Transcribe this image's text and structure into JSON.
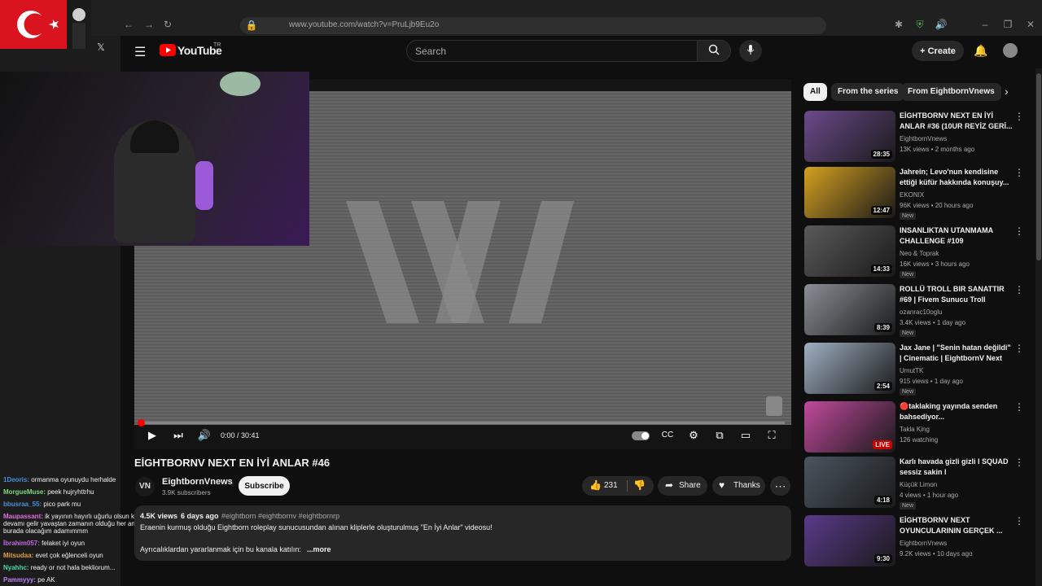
{
  "browser": {
    "url": "www.youtube.com/watch?v=PruLjb9Eu2o"
  },
  "header": {
    "logo_text": "YouTube",
    "logo_region": "TR",
    "search_placeholder": "Search",
    "create_label": "Create"
  },
  "video": {
    "title": "EİGHTBORNV NEXT EN İYİ ANLAR #46",
    "time": "0:00 / 30:41",
    "progress_fraction": 0.0,
    "channel_initials": "VN",
    "channel": "EightbornVnews",
    "subscribers": "3.9K subscribers",
    "subscribe_label": "Subscribe",
    "likes": "231",
    "share_label": "Share",
    "thanks_label": "Thanks",
    "desc_views": "4.5K views",
    "desc_date": "6 days ago",
    "desc_tags": "#eightborn #eightbornv #eightbornrp",
    "desc_line1": "Eraenin kurmuş olduğu Eightborn roleplay sunucusundan alınan kliplerle oluşturulmuş \"En İyi Anlar\" videosu!",
    "desc_line2": "Ayrıcalıklardan yararlanmak için bu kanala katılın:",
    "more_label": "...more"
  },
  "chips": [
    "All",
    "From the series",
    "From EightbornVnews"
  ],
  "recommendations": [
    {
      "title": "EİGHTBORNV NEXT EN İYİ ANLAR #36 (10UR REYİZ GERİ...",
      "channel": "EightbornVnews",
      "meta": "13K views • 2 months ago",
      "duration": "28:35",
      "new": "",
      "thumb_color": "#6b4a8a"
    },
    {
      "title": "Jahrein; Levo'nun kendisine ettiği küfür hakkında konuşuy...",
      "channel": "EKONIX",
      "meta": "96K views • 20 hours ago",
      "duration": "12:47",
      "new": "New",
      "thumb_color": "#d4a020"
    },
    {
      "title": "INSANLIKTAN UTANMAMA CHALLENGE #109",
      "channel": "Neo & Toprak",
      "meta": "16K views • 3 hours ago",
      "duration": "14:33",
      "new": "New",
      "thumb_color": "#5a5a5a"
    },
    {
      "title": "ROLLÜ TROLL BIR SANATTIR #69 | Fivem Sunucu Troll",
      "channel": "ozanrac10oglu",
      "meta": "3.4K views • 1 day ago",
      "duration": "8:39",
      "new": "New",
      "thumb_color": "#8a8f96"
    },
    {
      "title": "Jax Jane | \"Senin hatan değildi\" | Cinematic | EightbornV Next",
      "channel": "UmutTK",
      "meta": "915 views • 1 day ago",
      "duration": "2:54",
      "new": "New",
      "thumb_color": "#9fb0c2"
    },
    {
      "title": "🔴taklaking yayında senden bahsediyor...",
      "channel": "Takla King",
      "meta": "126 watching",
      "duration": "LIVE",
      "new": "",
      "thumb_color": "#c04a9c"
    },
    {
      "title": "Karlı havada gizli gizli l SQUAD sessiz sakin l",
      "channel": "Küçük Limon",
      "meta": "4 views • 1 hour ago",
      "duration": "4:18",
      "new": "New",
      "thumb_color": "#4a5560"
    },
    {
      "title": "EİGHTBORNV NEXT OYUNCULARININ GERÇEK ...",
      "channel": "EightbornVnews",
      "meta": "9.2K views • 10 days ago",
      "duration": "9:30",
      "new": "",
      "thumb_color": "#5a3a8a"
    }
  ],
  "chat": [
    {
      "user": "1Deoris:",
      "msg": "ormanma oyunuydu herhalde",
      "color": "#4a8fd8"
    },
    {
      "user": "MorgueMuse:",
      "msg": "peek hujryhttrhu",
      "color": "#7fd97f"
    },
    {
      "user": "bbusraa_55:",
      "msg": "pico park mu",
      "color": "#4a8fd8"
    },
    {
      "user": "Maupassant:",
      "msg": "ik yayının hayırlı uğurlu olsun kuzen umarım devamı gelir yavaştan zamanın olduğu her an geleceğim ve burada olacağım adamımmm",
      "color": "#e070e0"
    },
    {
      "user": "İbrahim057:",
      "msg": "felaket iyi oyun",
      "color": "#c06ae0"
    },
    {
      "user": "Mitsudaa:",
      "msg": "evet çok eğlenceli oyun",
      "color": "#e0a040"
    },
    {
      "user": "Nyahhc:",
      "msg": "ready or not hala bekliorum...",
      "color": "#4ad8a8"
    },
    {
      "user": "Pammyyy:",
      "msg": "pe AK",
      "color": "#c080ff"
    }
  ]
}
